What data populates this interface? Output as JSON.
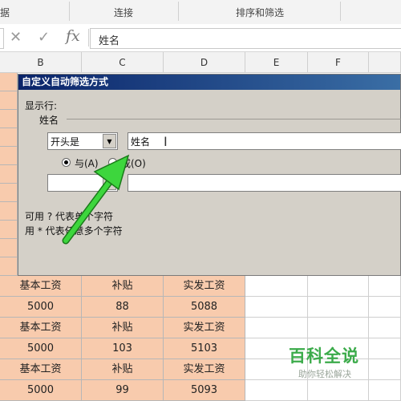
{
  "ribbon": {
    "group_left": "据",
    "group_connect": "连接",
    "group_sort": "排序和筛选"
  },
  "formula_bar": {
    "cancel_icon": "close-icon",
    "enter_icon": "check-icon",
    "function_label": "fx",
    "value": "姓名"
  },
  "columns": [
    "B",
    "C",
    "D",
    "E",
    "F"
  ],
  "sheet_rows": [
    [
      "基本工资",
      "补贴",
      "实发工资"
    ],
    [
      "5000",
      "88",
      "5088"
    ],
    [
      "基本工资",
      "补贴",
      "实发工资"
    ],
    [
      "5000",
      "103",
      "5103"
    ],
    [
      "基本工资",
      "补贴",
      "实发工资"
    ],
    [
      "5000",
      "99",
      "5093"
    ]
  ],
  "dialog": {
    "title": "自定义自动筛选方式",
    "show_rows_label": "显示行:",
    "field_label": "姓名",
    "operator1_value": "开头是",
    "criteria1_value": "姓名",
    "radio_and_label": "与(A)",
    "radio_or_label": "或(O)",
    "radio_selected": "and",
    "operator2_value": "",
    "criteria2_value": "",
    "hint1": "可用 ? 代表单个字符",
    "hint2": "用 * 代表任意多个字符"
  },
  "annotation": {
    "arrow_color": "#3dd63d"
  },
  "watermark": {
    "title": "百科全说",
    "subtitle": "助你轻松解决"
  },
  "colors": {
    "peach": "#f8cbad",
    "dialog_bg": "#d4d0c8",
    "title_bar": "#0a246a",
    "watermark_green": "#3bab4a"
  }
}
